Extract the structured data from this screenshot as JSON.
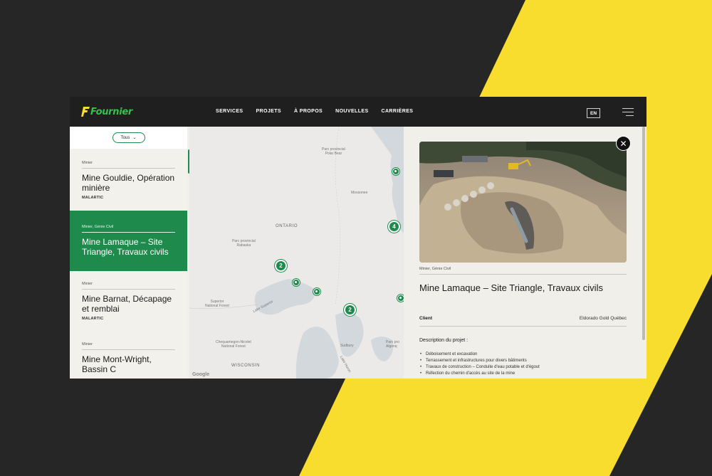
{
  "colors": {
    "background": "#262626",
    "accent_yellow": "#f9dd2e",
    "brand_green": "#1e8a4c",
    "logo_green": "#36c04c",
    "topbar": "#1f1f1f"
  },
  "header": {
    "logo_text": "Fournier",
    "nav": [
      "SERVICES",
      "PROJETS",
      "À PROPOS",
      "NOUVELLES",
      "CARRIÈRES"
    ],
    "lang": "EN",
    "menu_icon": "hamburger-icon"
  },
  "filter": {
    "selected": "Tous"
  },
  "projects": [
    {
      "category": "Minier",
      "title": "Mine Gouldie, Opération minière",
      "location": "MALARTIC",
      "active": false
    },
    {
      "category": "Minier, Génie Civil",
      "title": "Mine Lamaque – Site Triangle, Travaux civils",
      "location": "",
      "active": true
    },
    {
      "category": "Minier",
      "title": "Mine Barnat, Décapage et remblai",
      "location": "MALARTIC",
      "active": false
    },
    {
      "category": "Minier",
      "title": "Mine Mont-Wright, Bassin C",
      "location": "",
      "active": false
    }
  ],
  "map": {
    "labels": {
      "polar_bear": "Parc provincial\nPolar Bear",
      "ontario": "ONTARIO",
      "rabaska": "Parc provincial\nRabaska",
      "superior": "Superior\nNational Forest",
      "lake_superior": "Lake Superior",
      "chequamegon": "Chequamegon-Nicolet\nNational Forest",
      "wisconsin": "WISCONSIN",
      "algonquin": "Parc pro\nAlgonq",
      "moosonee": "Moosonee",
      "lake_huron": "Lake Huron",
      "sudbury": "Sudbury"
    },
    "clusters": [
      "4",
      "2",
      "2"
    ],
    "google": "Google"
  },
  "detail": {
    "category": "Minier, Génie Civil",
    "title": "Mine Lamaque – Site Triangle, Travaux civils",
    "client_label": "Client",
    "client_value": "Eldorado Gold Québec",
    "description_label": "Description du projet :",
    "items": [
      "Déboisement et excavation",
      "Terrassement et infrastructures pour divers bâtiments",
      "Travaux de construction – Conduite d'eau potable et d'égout",
      "Réfection du chemin d'accès au site de la mine"
    ],
    "close_icon": "close-icon"
  }
}
